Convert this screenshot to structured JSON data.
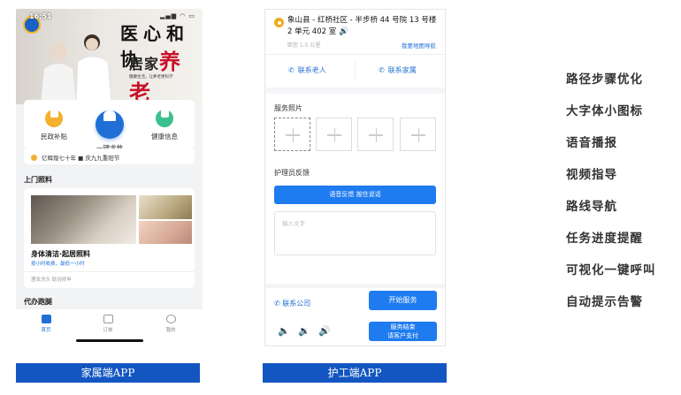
{
  "family_app": {
    "status_time": "16:51",
    "banner": {
      "slogan_line1": "医心和协",
      "slogan_line2_prefix": "居家",
      "slogan_line2_big": "养老",
      "subtitle": "健康生活，让养老更科学"
    },
    "services": [
      {
        "label": "民政补贴",
        "icon": "coin-icon"
      },
      {
        "label": "一键求救",
        "icon": "alarm-icon"
      },
      {
        "label": "健康信息",
        "icon": "health-icon"
      }
    ],
    "notice": "亿辉煌七十年 ■ 庆九九重阳节",
    "section_visit": "上门照料",
    "visit_card": {
      "name": "身体清洁·起居照料",
      "tags": "按小时收费，最低一小时",
      "more": "理发洗头 助浴修甲"
    },
    "section_errand": "代办跑腿",
    "tabs": [
      {
        "label": "首页",
        "icon": "home-icon",
        "active": true
      },
      {
        "label": "订单",
        "icon": "order-icon",
        "active": false
      },
      {
        "label": "我的",
        "icon": "profile-icon",
        "active": false
      }
    ]
  },
  "caregiver_app": {
    "address": "象山县 - 红桥社区 - 半步桥 44 号院 13 号楼 2 单元 402 室",
    "distance": "距您 1.5 公里",
    "map_nav": "我要地图导航",
    "contact_elder": "联系老人",
    "contact_family": "联系家属",
    "photos_title": "服务照片",
    "feedback_title": "护理员反馈",
    "voice_button": "语音反馈  按住说话",
    "input_placeholder": "输入文字",
    "contact_company": "联系公司",
    "start_button": "开始服务",
    "end_button_line1": "服务结束",
    "end_button_line2": "请客户支付"
  },
  "captions": {
    "family": "家属端APP",
    "caregiver": "护工端APP"
  },
  "features": [
    "路径步骤优化",
    "大字体小图标",
    "语音播报",
    "视频指导",
    "路线导航",
    "任务进度提醒",
    "可视化一键呼叫",
    "自动提示告警"
  ],
  "colors": {
    "primary_blue": "#1f7bf0",
    "caption_blue": "#1356c1",
    "accent_yellow": "#f4b02e",
    "accent_green": "#3cc08f",
    "slogan_red": "#c8122a"
  }
}
